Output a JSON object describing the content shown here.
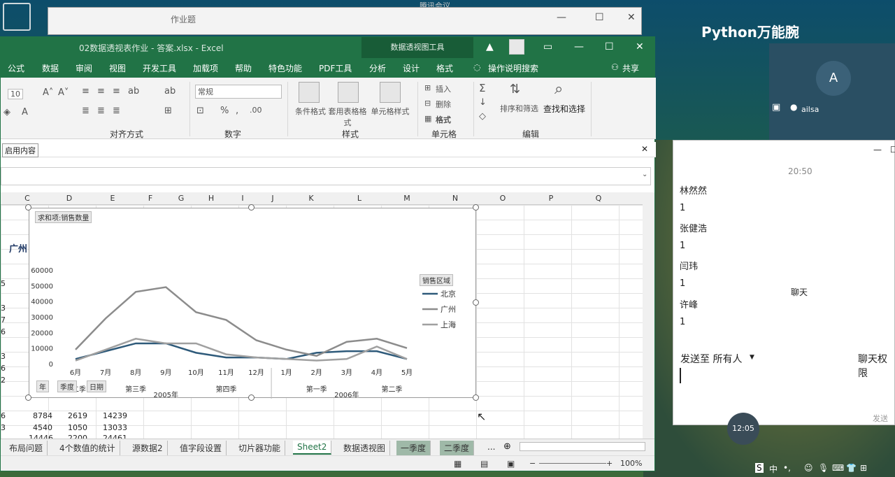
{
  "back_window": {
    "title": "作业题",
    "top_center": "腾讯会议"
  },
  "excel": {
    "filename": "02数据透视表作业 - 答案.xlsx - Excel",
    "pivot_tools": "数据透视图工具",
    "menu": [
      "公式",
      "数据",
      "审阅",
      "视图",
      "开发工具",
      "加载项",
      "帮助",
      "特色功能",
      "PDF工具",
      "分析",
      "设计",
      "格式",
      "操作说明搜索",
      "共享"
    ],
    "ribbon": {
      "font_size": "10",
      "number_format": "常规",
      "groups": [
        "对齐方式",
        "数字",
        "样式",
        "单元格",
        "编辑"
      ],
      "style_items": [
        "条件格式",
        "套用表格格式",
        "单元格样式"
      ],
      "cell_items": [
        "插入",
        "删除",
        "格式"
      ],
      "edit_items": [
        "排序和筛选",
        "查找和选择"
      ]
    },
    "notification": "启用内容",
    "columns": [
      "C",
      "D",
      "E",
      "F",
      "G",
      "H",
      "I",
      "J",
      "K",
      "L",
      "M",
      "N",
      "O",
      "P",
      "Q"
    ],
    "cells": {
      "guangzhou": "广州",
      "left_col": [
        "5",
        "3",
        "7",
        "6",
        "3",
        "6",
        "2",
        "6",
        "3"
      ],
      "row_a": [
        "8784",
        "2619",
        "14239"
      ],
      "row_b": [
        "4540",
        "1050",
        "13033"
      ],
      "row_c": [
        "14446",
        "2200",
        "24461"
      ]
    },
    "tabs": [
      "布局问题",
      "4个数值的统计",
      "源数据2",
      "值字段设置",
      "切片器功能",
      "Sheet2",
      "数据透视图",
      "一季度",
      "二季度",
      "..."
    ],
    "zoom": "100%"
  },
  "chart_data": {
    "type": "line",
    "title": "求和项:销售数量",
    "legend_title": "销售区域",
    "legend_position": "right",
    "ylim": [
      0,
      60000
    ],
    "yticks": [
      "60000",
      "50000",
      "40000",
      "30000",
      "20000",
      "10000",
      "0"
    ],
    "categories": [
      "6月",
      "7月",
      "8月",
      "9月",
      "10月",
      "11月",
      "12月",
      "1月",
      "2月",
      "3月",
      "4月",
      "5月"
    ],
    "quarters": [
      "第二季",
      "第三季",
      "第四季",
      "第一季",
      "第二季"
    ],
    "years": [
      "2005年",
      "2006年"
    ],
    "field_buttons": [
      "年",
      "季度",
      "日期"
    ],
    "series": [
      {
        "name": "北京",
        "color": "#2e5a7a",
        "values": [
          3000,
          8000,
          13000,
          13000,
          7000,
          4000,
          4000,
          3000,
          7000,
          8000,
          8000,
          3000
        ]
      },
      {
        "name": "广州",
        "color": "#8c8c8c",
        "values": [
          9000,
          29000,
          46000,
          49000,
          33000,
          28000,
          15000,
          9000,
          5000,
          14000,
          16000,
          10000
        ]
      },
      {
        "name": "上海",
        "color": "#a0a0a0",
        "values": [
          2000,
          9000,
          16000,
          13000,
          13000,
          6000,
          4000,
          3000,
          2000,
          3000,
          11000,
          3000
        ]
      }
    ]
  },
  "meeting": {
    "brand": "Python万能腕",
    "avatar_letter": "A",
    "user": "ailsa",
    "chat_title": "聊天",
    "chat_time": "20:50",
    "messages": [
      {
        "name": "林然然",
        "text": "1"
      },
      {
        "name": "张健浩",
        "text": "1"
      },
      {
        "name": "闫玮",
        "text": "1"
      },
      {
        "name": "许峰",
        "text": "1"
      }
    ],
    "send_to": "发送至 所有人",
    "permission": "聊天权限",
    "send_btn": "发送",
    "timer": "12:05",
    "taskbar_ime": "中"
  }
}
